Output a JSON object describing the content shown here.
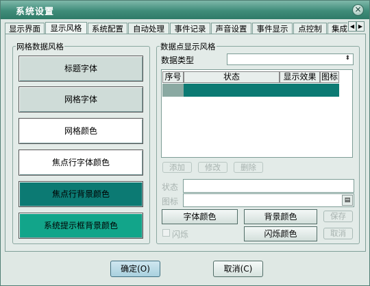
{
  "window": {
    "title": "系统设置"
  },
  "tabs": [
    "显示界面",
    "显示风格",
    "系统配置",
    "自动处理",
    "事件记录",
    "声音设置",
    "事件显示",
    "点控制",
    "集成"
  ],
  "active_tab": "显示风格",
  "grid_style": {
    "title": "网格数据风格",
    "buttons": [
      {
        "label": "标题字体",
        "bg": "#cfdcd8",
        "fg": "#000000"
      },
      {
        "label": "网格字体",
        "bg": "#cfdcd8",
        "fg": "#000000"
      },
      {
        "label": "网格颜色",
        "bg": "#ffffff",
        "fg": "#000000"
      },
      {
        "label": "焦点行字体颜色",
        "bg": "#ffffff",
        "fg": "#000000"
      },
      {
        "label": "焦点行背景颜色",
        "bg": "#0c7a73",
        "fg": "#000000"
      },
      {
        "label": "系统提示框背景颜色",
        "bg": "#12a58a",
        "fg": "#000000"
      }
    ]
  },
  "point_style": {
    "title": "数据点显示风格",
    "data_type_label": "数据类型",
    "data_type_value": "",
    "table_headers": [
      "序号",
      "状态",
      "显示效果",
      "图标"
    ],
    "add_label": "添加",
    "modify_label": "修改",
    "delete_label": "删除",
    "state_label": "状态",
    "icon_label": "图标",
    "font_color_label": "字体颜色",
    "bg_color_label": "背景颜色",
    "save_label": "保存",
    "blink_label": "闪烁",
    "blink_color_label": "闪烁颜色",
    "cancel_small_label": "取消"
  },
  "footer": {
    "ok_label": "确定(O)",
    "cancel_label": "取消(C)"
  },
  "colors": {
    "accent": "#0c7a73",
    "titlebar": "#3f8c79"
  }
}
